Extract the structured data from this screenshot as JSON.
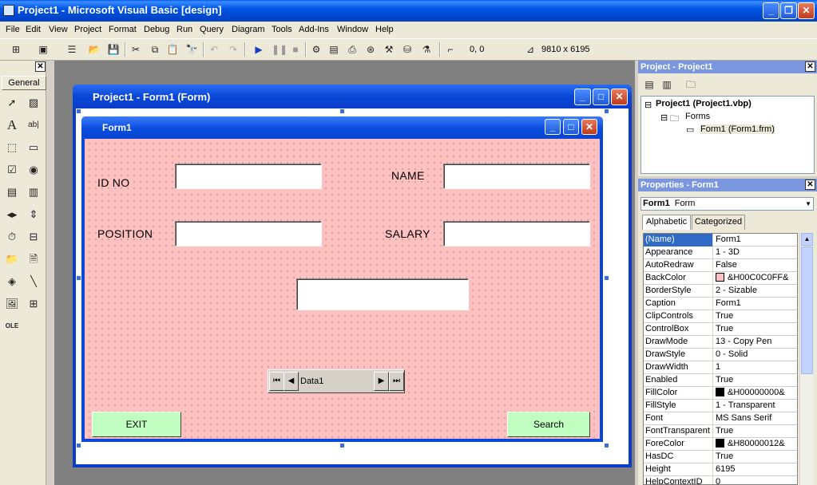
{
  "window": {
    "title": "Project1 - Microsoft Visual Basic [design]"
  },
  "menu": [
    "File",
    "Edit",
    "View",
    "Project",
    "Format",
    "Debug",
    "Run",
    "Query",
    "Diagram",
    "Tools",
    "Add-Ins",
    "Window",
    "Help"
  ],
  "toolbar": {
    "position": "0, 0",
    "size": "9810 x 6195"
  },
  "toolbox": {
    "tab_label": "General"
  },
  "designer": {
    "title": "Project1 - Form1 (Form)"
  },
  "form": {
    "caption": "Form1",
    "labels": {
      "id_no": "ID NO",
      "name": "NAME",
      "position": "POSITION",
      "salary": "SALARY"
    },
    "data_caption": "Data1",
    "exit_label": "EXIT",
    "search_label": "Search",
    "backcolor": "#ffc0c0"
  },
  "project": {
    "title": "Project - Project1",
    "root": "Project1 (Project1.vbp)",
    "folder": "Forms",
    "item": "Form1 (Form1.frm)"
  },
  "properties": {
    "title": "Properties - Form1",
    "object_name": "Form1",
    "object_type": "Form",
    "tabs": [
      "Alphabetic",
      "Categorized"
    ],
    "rows": [
      {
        "k": "(Name)",
        "v": "Form1"
      },
      {
        "k": "Appearance",
        "v": "1 - 3D"
      },
      {
        "k": "AutoRedraw",
        "v": "False"
      },
      {
        "k": "BackColor",
        "v": "&H00C0C0FF&"
      },
      {
        "k": "BorderStyle",
        "v": "2 - Sizable"
      },
      {
        "k": "Caption",
        "v": "Form1"
      },
      {
        "k": "ClipControls",
        "v": "True"
      },
      {
        "k": "ControlBox",
        "v": "True"
      },
      {
        "k": "DrawMode",
        "v": "13 - Copy Pen"
      },
      {
        "k": "DrawStyle",
        "v": "0 - Solid"
      },
      {
        "k": "DrawWidth",
        "v": "1"
      },
      {
        "k": "Enabled",
        "v": "True"
      },
      {
        "k": "FillColor",
        "v": "&H00000000&"
      },
      {
        "k": "FillStyle",
        "v": "1 - Transparent"
      },
      {
        "k": "Font",
        "v": "MS Sans Serif"
      },
      {
        "k": "FontTransparent",
        "v": "True"
      },
      {
        "k": "ForeColor",
        "v": "&H80000012&"
      },
      {
        "k": "HasDC",
        "v": "True"
      },
      {
        "k": "Height",
        "v": "6195"
      },
      {
        "k": "HelpContextID",
        "v": "0"
      }
    ]
  }
}
